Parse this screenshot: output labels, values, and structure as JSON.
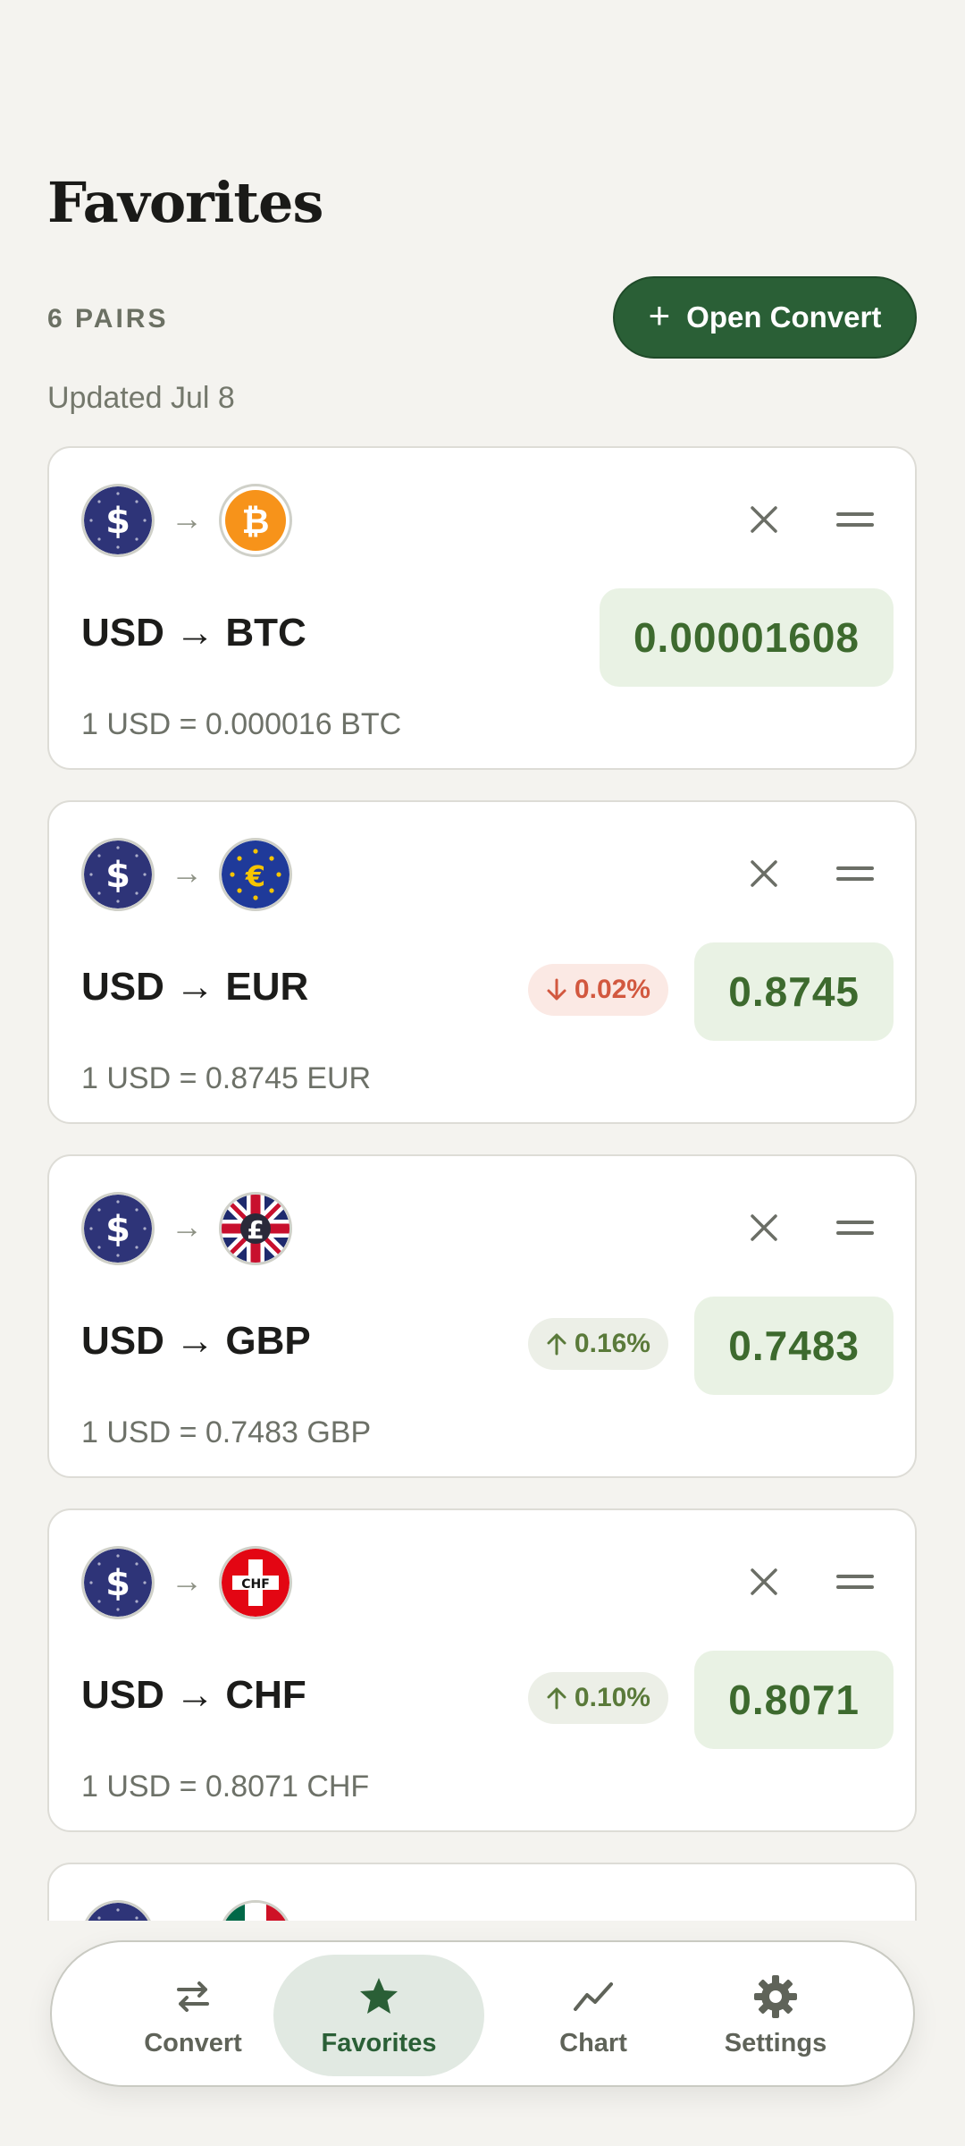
{
  "header": {
    "title": "Favorites",
    "pairs_count": "6 PAIRS",
    "open_convert_label": "Open Convert",
    "updated": "Updated Jul 8"
  },
  "cards": [
    {
      "from": "USD",
      "to": "BTC",
      "pair": "USD → BTC",
      "rate": "0.00001608",
      "conversion": "1 USD = 0.000016 BTC",
      "change": null,
      "from_icon": "dollar-flag-icon",
      "to_icon": "bitcoin-icon"
    },
    {
      "from": "USD",
      "to": "EUR",
      "pair": "USD → EUR",
      "rate": "0.8745",
      "conversion": "1 USD = 0.8745 EUR",
      "change": {
        "direction": "down",
        "text": "0.02%"
      },
      "from_icon": "dollar-flag-icon",
      "to_icon": "euro-flag-icon"
    },
    {
      "from": "USD",
      "to": "GBP",
      "pair": "USD → GBP",
      "rate": "0.7483",
      "conversion": "1 USD = 0.7483 GBP",
      "change": {
        "direction": "up",
        "text": "0.16%"
      },
      "from_icon": "dollar-flag-icon",
      "to_icon": "pound-flag-icon"
    },
    {
      "from": "USD",
      "to": "CHF",
      "pair": "USD → CHF",
      "rate": "0.8071",
      "conversion": "1 USD = 0.8071 CHF",
      "change": {
        "direction": "up",
        "text": "0.10%"
      },
      "from_icon": "dollar-flag-icon",
      "to_icon": "swiss-flag-icon",
      "to_flag_text": "CHF"
    }
  ],
  "nav": {
    "items": [
      {
        "label": "Convert",
        "icon": "swap-icon",
        "active": false
      },
      {
        "label": "Favorites",
        "icon": "star-icon",
        "active": true
      },
      {
        "label": "Chart",
        "icon": "chart-line-icon",
        "active": false
      },
      {
        "label": "Settings",
        "icon": "gear-icon",
        "active": false
      }
    ]
  },
  "colors": {
    "background": "#f4f3ef",
    "accent": "#2a5f36",
    "rate_bg": "#e9f2e4",
    "rate_text": "#3d6a2e",
    "down": "#d2583f",
    "up": "#5a7a3a"
  }
}
